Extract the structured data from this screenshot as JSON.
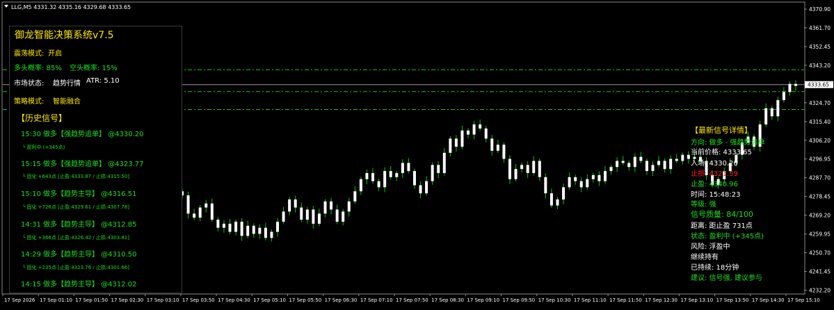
{
  "window": {
    "title": "LLG,M5  4331.32 4335.16 4329.68 4333.65",
    "current_price": "4333.65"
  },
  "chart_data": {
    "type": "candlestick",
    "symbol": "LLG",
    "timeframe": "M5",
    "ohlc_header": {
      "open": 4331.32,
      "high": 4335.16,
      "low": 4329.68,
      "close": 4333.65
    },
    "ylim": [
      4231,
      4373
    ],
    "y_ticks": [
      "4370.90",
      "4361.70",
      "4352.45",
      "4343.20",
      "4333.95",
      "4324.70",
      "4315.40",
      "4306.20",
      "4296.95",
      "4287.70",
      "4278.45",
      "4269.20",
      "4259.95",
      "4250.70",
      "4241.45",
      "4232.20"
    ],
    "x_ticks": [
      "17 Sep 2026",
      "17 Sep 01:10",
      "17 Sep 01:50",
      "17 Sep 02:30",
      "17 Sep 03:10",
      "17 Sep 03:50",
      "17 Sep 04:30",
      "17 Sep 05:10",
      "17 Sep 05:50",
      "17 Sep 06:30",
      "17 Sep 07:10",
      "17 Sep 07:50",
      "17 Sep 08:30",
      "17 Sep 09:10",
      "17 Sep 09:50",
      "17 Sep 10:30",
      "17 Sep 11:10",
      "17 Sep 11:50",
      "17 Sep 12:30",
      "17 Sep 13:10",
      "17 Sep 13:50",
      "17 Sep 14:30",
      "17 Sep 15:10"
    ],
    "levels": {
      "entry": 4330.2,
      "stop_loss": 4321.39,
      "take_profit": 4340.96
    },
    "closes": [
      4279,
      4270,
      4268,
      4273,
      4275,
      4267,
      4263,
      4265,
      4261,
      4266,
      4259,
      4264,
      4260,
      4263,
      4258,
      4261,
      4266,
      4271,
      4277,
      4273,
      4267,
      4272,
      4265,
      4270,
      4276,
      4272,
      4266,
      4271,
      4276,
      4281,
      4287,
      4290,
      4286,
      4283,
      4291,
      4288,
      4290,
      4295,
      4291,
      4284,
      4280,
      4286,
      4294,
      4290,
      4300,
      4307,
      4303,
      4311,
      4309,
      4314,
      4312,
      4307,
      4301,
      4304,
      4297,
      4287,
      4292,
      4294,
      4290,
      4296,
      4288,
      4280,
      4274,
      4277,
      4283,
      4288,
      4286,
      4283,
      4287,
      4289,
      4286,
      4291,
      4293,
      4296,
      4295,
      4293,
      4298,
      4296,
      4291,
      4294,
      4296,
      4292,
      4297,
      4296,
      4299,
      4297,
      4298,
      4296,
      4289,
      4284,
      4287,
      4291,
      4295,
      4299,
      4305,
      4308,
      4303,
      4314,
      4322,
      4318,
      4326,
      4330,
      4334,
      4333
    ],
    "candle_color": "#ffffff",
    "wick_color": "#00d000"
  },
  "panel": {
    "title": "御龙智能决策系统v7.5",
    "oscillation_label": "震荡模式:",
    "oscillation_value": "开启",
    "bull_prob": "多头概率: 85%",
    "bear_prob": "空头概率: 15%",
    "market_label": "市场状态:",
    "market_value": "趋势行情",
    "atr": "ATR: 5.10",
    "strategy_label": "策略模式:",
    "strategy_value": "智能融合",
    "history_title": "【历史信号】",
    "history": [
      {
        "signal": "15:30 做多【强趋势追单】 @4330.20",
        "detail": "└ 盈利中 (+345点)"
      },
      {
        "signal": "15:15 做多【强趋势追单】 @4323.77",
        "detail": "└ 固化 +643点 [止盈:4333.87 / 止损:4315.50]"
      },
      {
        "signal": "15:10 做多【趋势主导】 @4316.51",
        "detail": "└ 固化 +726点 [止盈:4329.61 / 止损:4307.78]"
      },
      {
        "signal": "14:31 做多【趋势主导】 @4312.85",
        "detail": "└ 固化 +366点 [止盈:4326.42 / 止损:4303.81]"
      },
      {
        "signal": "14:29 做多【趋势主导】 @4310.50",
        "detail": "└ 固化 +235点 [止盈:4323.76 / 止损:4301.66]"
      },
      {
        "signal": "14:15 做多【趋势主导】 @4312.02",
        "detail": ""
      }
    ]
  },
  "detail": {
    "title": "【最新信号详情】",
    "direction": "方向: 做多 - 强趋势追单",
    "current_price": "当前价格: 4333.65",
    "entry": "入场: 4330.20",
    "stop": "止损: 4321.39",
    "take_profit": "止盈: 4340.96",
    "time": "时间: 15:48:23",
    "level": "等级: 强",
    "quality": "信号质量: 84/100",
    "distance": "距离: 距止盈 731点",
    "status": "状态: 盈利中 (+345点)",
    "risk": "风险: 浮盈中",
    "hold": "继续持有",
    "duration": "已持续: 18分钟",
    "advice": "建议: 信号强, 建议参与"
  }
}
